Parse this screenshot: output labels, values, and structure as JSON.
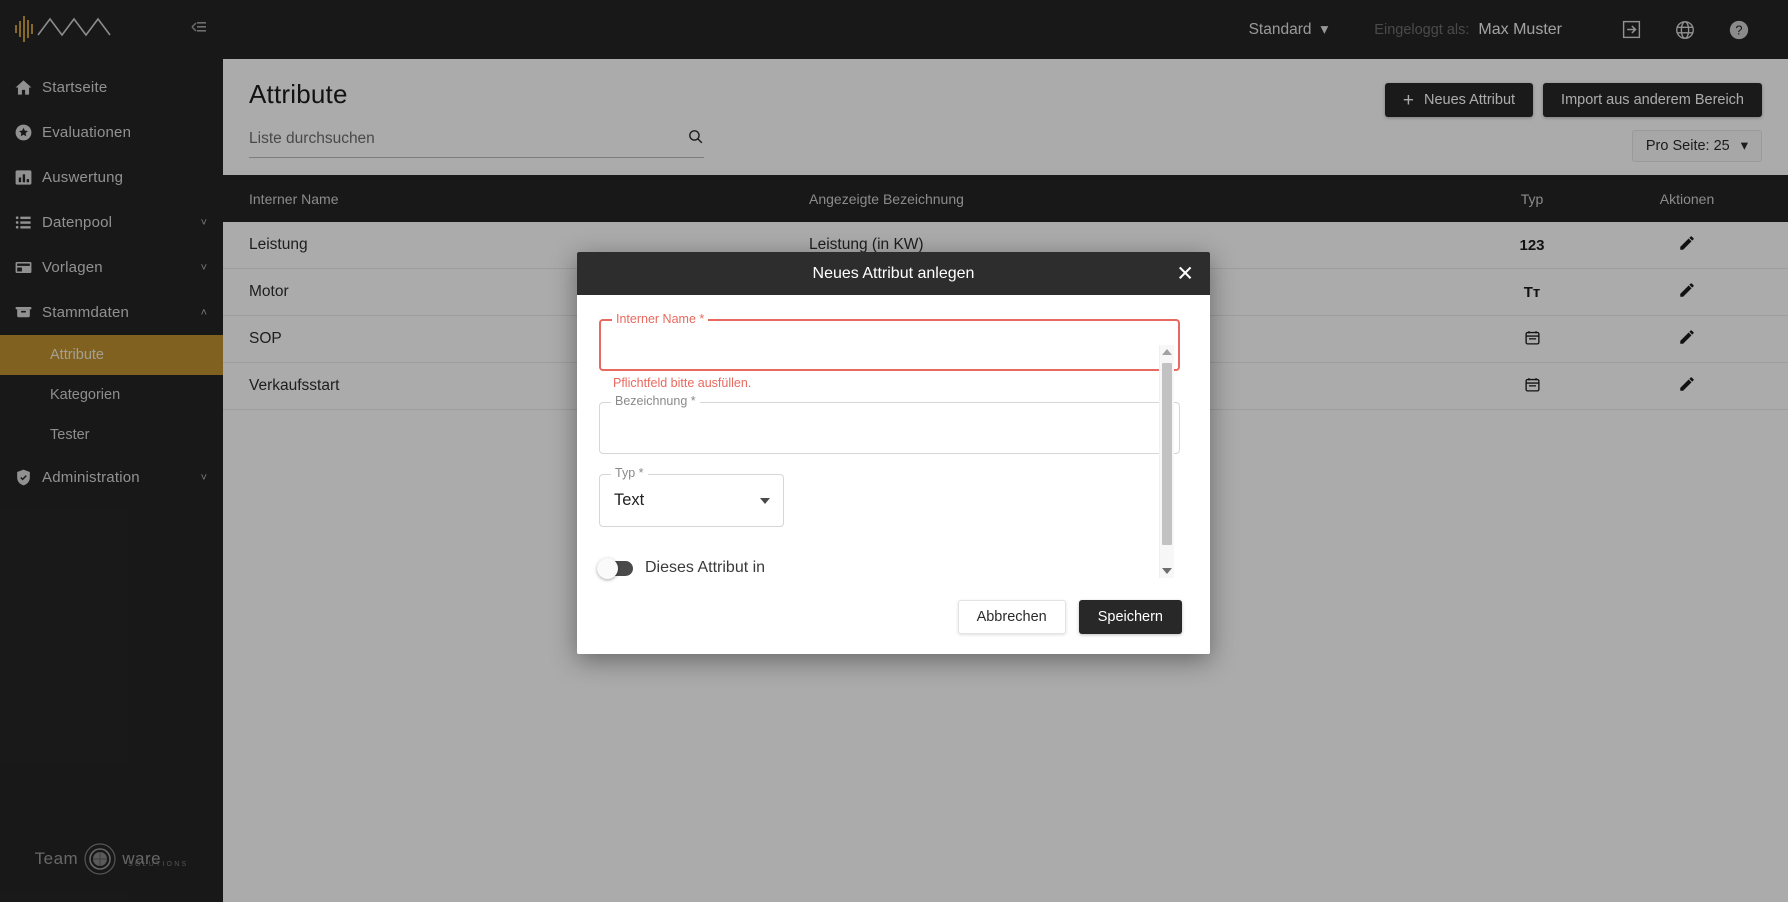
{
  "brand": {
    "logo_alt": "wave-logo",
    "accent": "#c1912f",
    "footer_logo_text": "Team",
    "footer_logo_text2": "ware",
    "footer_logo_sub": "SOLUTIONS"
  },
  "sidebar": {
    "collapse_title": "Menü einklappen",
    "items": [
      {
        "label": "Startseite",
        "icon": "home-icon",
        "expandable": false,
        "chevron": ""
      },
      {
        "label": "Evaluationen",
        "icon": "star-icon",
        "expandable": false,
        "chevron": ""
      },
      {
        "label": "Auswertung",
        "icon": "bar-chart-icon",
        "expandable": false,
        "chevron": ""
      },
      {
        "label": "Datenpool",
        "icon": "list-icon",
        "expandable": true,
        "chevron": "˅"
      },
      {
        "label": "Vorlagen",
        "icon": "layout-icon",
        "expandable": true,
        "chevron": "˅"
      },
      {
        "label": "Stammdaten",
        "icon": "archive-icon",
        "expandable": true,
        "chevron": "˄"
      }
    ],
    "subitems": [
      {
        "label": "Attribute",
        "active": true
      },
      {
        "label": "Kategorien",
        "active": false
      },
      {
        "label": "Tester",
        "active": false
      }
    ],
    "admin": {
      "label": "Administration",
      "icon": "shield-check-icon",
      "chevron": "˅"
    }
  },
  "topbar": {
    "scope_select": "Standard",
    "scope_caret": "▾",
    "logged_in_label": "Eingeloggt als:",
    "user_name": "Max Muster",
    "icons": [
      {
        "name": "logout-icon"
      },
      {
        "name": "globe-icon"
      },
      {
        "name": "help-icon"
      }
    ]
  },
  "page": {
    "title": "Attribute",
    "new_attribute_button": "Neues Attribut",
    "new_attribute_plus": "+",
    "import_button": "Import aus anderem Bereich",
    "per_page_label": "Pro Seite: 25",
    "per_page_caret": "▾",
    "search_placeholder": "Liste durchsuchen",
    "search_value": ""
  },
  "table": {
    "columns": [
      "Interner Name",
      "Angezeigte Bezeichnung",
      "Typ",
      "Aktionen"
    ],
    "rows": [
      {
        "name": "Leistung",
        "desc": "Leistung (in KW)",
        "typ": "123",
        "typ_kind": "number",
        "action": "edit-icon"
      },
      {
        "name": "Motor",
        "desc": "",
        "typ": "Tт",
        "typ_kind": "text",
        "action": "edit-icon"
      },
      {
        "name": "SOP",
        "desc": "",
        "typ": "",
        "typ_kind": "date",
        "action": "edit-icon"
      },
      {
        "name": "Verkaufsstart",
        "desc": "",
        "typ": "",
        "typ_kind": "date",
        "action": "edit-icon"
      }
    ]
  },
  "modal": {
    "title": "Neues Attribut anlegen",
    "close_glyph": "✕",
    "fields": {
      "internal_name": {
        "label": "Interner Name *",
        "value": "",
        "error": "Pflichtfeld bitte ausfüllen.",
        "error_color": "#e8695f"
      },
      "designation": {
        "label": "Bezeichnung *",
        "value": ""
      },
      "type": {
        "label": "Typ *",
        "value": "Text",
        "caret": "▾"
      }
    },
    "toggle": {
      "label": "Dieses Attribut in",
      "on": false
    },
    "cancel_button": "Abbrechen",
    "save_button": "Speichern"
  }
}
